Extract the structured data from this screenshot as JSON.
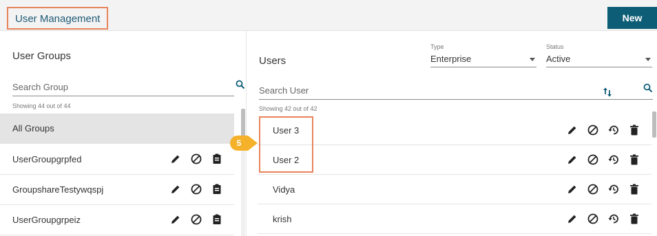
{
  "header": {
    "title": "User Management",
    "new_label": "New"
  },
  "groups": {
    "title": "User Groups",
    "search_placeholder": "Search Group",
    "showing": "Showing 44 out of 44",
    "items": [
      {
        "label": "All Groups",
        "active": true
      },
      {
        "label": "UserGroupgrpfed"
      },
      {
        "label": "GroupshareTestywqspj"
      },
      {
        "label": "UserGroupgrpeiz"
      }
    ]
  },
  "users": {
    "title": "Users",
    "type_label": "Type",
    "type_value": "Enterprise",
    "status_label": "Status",
    "status_value": "Active",
    "search_placeholder": "Search User",
    "showing": "Showing 42 out of 42",
    "items": [
      {
        "label": "User 3"
      },
      {
        "label": "User 2"
      },
      {
        "label": "Vidya"
      },
      {
        "label": "krish"
      }
    ]
  },
  "annotation": {
    "step": "5"
  },
  "colors": {
    "accent": "#0d5d77",
    "highlight": "#e8835a",
    "badge": "#f5b12a"
  },
  "icons": {
    "row_actions_group": [
      "pencil-icon",
      "block-icon",
      "clipboard-icon"
    ],
    "row_actions_user": [
      "pencil-icon",
      "block-icon",
      "restore-icon",
      "trash-icon"
    ]
  }
}
